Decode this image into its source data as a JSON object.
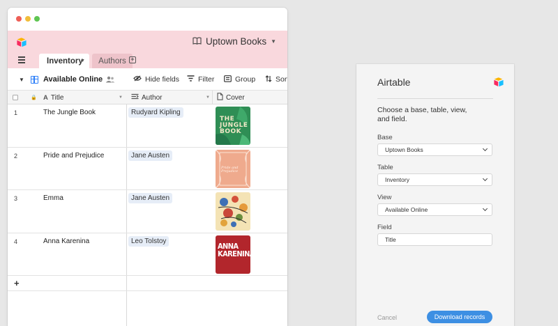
{
  "app": {
    "base_title": "Uptown Books",
    "tabs": [
      {
        "label": "Inventory"
      },
      {
        "label": "Authors"
      }
    ],
    "toolbar": {
      "view_name": "Available Online",
      "hide_fields": "Hide fields",
      "filter": "Filter",
      "group": "Group",
      "sort": "Sort"
    },
    "columns": [
      "Title",
      "Author",
      "Cover"
    ],
    "rows": [
      {
        "num": "1",
        "title": "The Jungle Book",
        "author": "Rudyard Kipling",
        "cover_text": "THE JUNGLE BOOK"
      },
      {
        "num": "2",
        "title": "Pride and Prejudice",
        "author": "Jane Austen",
        "cover_text": "Pride and Prejudice"
      },
      {
        "num": "3",
        "title": "Emma",
        "author": "Jane Austen",
        "cover_text": ""
      },
      {
        "num": "4",
        "title": "Anna Karenina",
        "author": "Leo Tolstoy",
        "cover_text": "ANNA KARENINA"
      }
    ],
    "add_row": "+",
    "colors": {
      "accent": "#2d7ff9",
      "base_bar": "#f9d8dd"
    }
  },
  "panel": {
    "title": "Airtable",
    "description": "Choose a base, table, view, and field.",
    "fields": [
      {
        "label": "Base",
        "value": "Uptown Books"
      },
      {
        "label": "Table",
        "value": "Inventory"
      },
      {
        "label": "View",
        "value": "Available Online"
      },
      {
        "label": "Field",
        "value": "Title"
      }
    ],
    "cancel": "Cancel",
    "download": "Download records",
    "colors": {
      "button": "#3d8fe3"
    }
  }
}
